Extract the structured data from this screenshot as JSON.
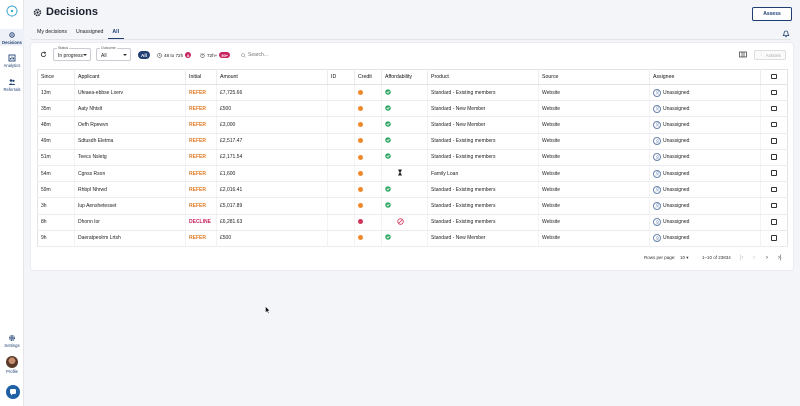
{
  "sidebar": {
    "items": [
      {
        "label": "Decisions",
        "icon": "gear-icon",
        "active": true
      },
      {
        "label": "Analytics",
        "icon": "chart-icon",
        "active": false
      },
      {
        "label": "Referrals",
        "icon": "people-icon",
        "active": false
      }
    ],
    "settings_label": "Settings",
    "profile_label": "Profile"
  },
  "header": {
    "title": "Decisions",
    "assess_label": "Assess"
  },
  "tabs": [
    {
      "label": "My decisions",
      "active": false
    },
    {
      "label": "Unassigned",
      "active": false
    },
    {
      "label": "All",
      "active": true
    }
  ],
  "filters": {
    "status_caption": "Status",
    "status_value": "In progress",
    "outcome_caption": "Outcome",
    "outcome_value": "All",
    "chip_all": "All",
    "chip_48_label": "48 to 72h",
    "chip_48_count": "8",
    "chip_72_label": "72h+",
    "chip_72_count": "50+",
    "search_placeholder": "Search...",
    "actions_label": "Actions"
  },
  "table": {
    "columns": [
      "Since",
      "Applicant",
      "Initial",
      "Amount",
      "ID",
      "Credit",
      "Affordability",
      "Product",
      "Source",
      "Assignee"
    ],
    "rows": [
      {
        "since": "13m",
        "applicant": "Ufeaea-ebbse Lxerv",
        "initial": "REFER",
        "amount": "£7,725.66",
        "id": "",
        "credit": "orange",
        "afford": "green",
        "product": "Standard - Existing members",
        "source": "Website",
        "assignee": "Unassigned"
      },
      {
        "since": "35m",
        "applicant": "Aaty Nhtslt",
        "initial": "REFER",
        "amount": "£500",
        "id": "",
        "credit": "orange",
        "afford": "green",
        "product": "Standard - New Member",
        "source": "Website",
        "assignee": "Unassigned"
      },
      {
        "since": "48m",
        "applicant": "Oefh Rpewvn",
        "initial": "REFER",
        "amount": "£3,000",
        "id": "",
        "credit": "orange",
        "afford": "green",
        "product": "Standard - New Member",
        "source": "Website",
        "assignee": "Unassigned"
      },
      {
        "since": "49m",
        "applicant": "Sdtusdh Eletma",
        "initial": "REFER",
        "amount": "£2,517.47",
        "id": "",
        "credit": "orange",
        "afford": "green",
        "product": "Standard - Existing members",
        "source": "Website",
        "assignee": "Unassigned"
      },
      {
        "since": "51m",
        "applicant": "Teecs Nsletg",
        "initial": "REFER",
        "amount": "£2,171.54",
        "id": "",
        "credit": "orange",
        "afford": "green",
        "product": "Standard - Existing members",
        "source": "Website",
        "assignee": "Unassigned"
      },
      {
        "since": "54m",
        "applicant": "Cgnss Rson",
        "initial": "REFER",
        "amount": "£1,600",
        "id": "",
        "credit": "orange",
        "afford": "hourglass",
        "product": "Family Loan",
        "source": "Website",
        "assignee": "Unassigned"
      },
      {
        "since": "59m",
        "applicant": "Rhbpl Nhrwd",
        "initial": "REFER",
        "amount": "£2,016.41",
        "id": "",
        "credit": "orange",
        "afford": "green",
        "product": "Standard - Existing members",
        "source": "Website",
        "assignee": "Unassigned"
      },
      {
        "since": "3h",
        "applicant": "Iup Aenshetesset",
        "initial": "REFER",
        "amount": "£5,017.89",
        "id": "",
        "credit": "orange",
        "afford": "green",
        "product": "Standard - Existing members",
        "source": "Website",
        "assignee": "Unassigned"
      },
      {
        "since": "8h",
        "applicant": "Dhonn Ior",
        "initial": "DECLINE",
        "amount": "£6,281.63",
        "id": "",
        "credit": "red",
        "afford": "blocked",
        "product": "Standard - Existing members",
        "source": "Website",
        "assignee": "Unassigned"
      },
      {
        "since": "9h",
        "applicant": "Daeratpeolrm Lrtsh",
        "initial": "REFER",
        "amount": "£500",
        "id": "",
        "credit": "orange",
        "afford": "green",
        "product": "Standard - New Member",
        "source": "Website",
        "assignee": "Unassigned"
      }
    ]
  },
  "pagination": {
    "rows_per_page_label": "Rows per page:",
    "rows_per_page": "10",
    "range": "1–10 of 23834"
  },
  "colors": {
    "brand": "#1f3f73",
    "refer": "#e07a24",
    "decline": "#c6225f",
    "credit_orange": "#ef8a2c",
    "credit_red": "#d2335a",
    "afford_green": "#3aaa6a"
  }
}
